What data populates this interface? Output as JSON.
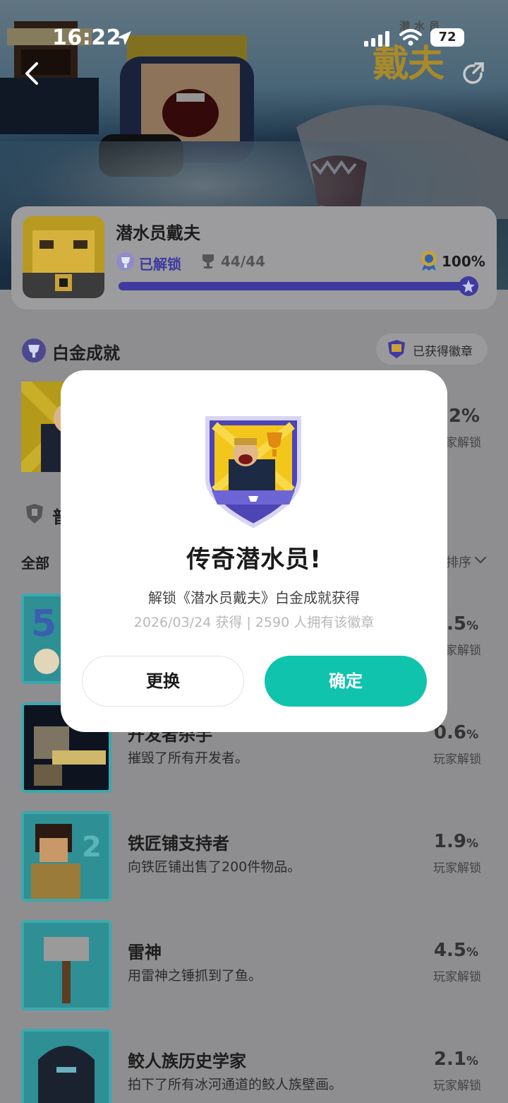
{
  "status_bar": {
    "time": "16:22",
    "battery": "72"
  },
  "logo": {
    "small": "潜水员",
    "big": "戴夫"
  },
  "game": {
    "title": "潜水员戴夫",
    "unlock_label": "已解锁",
    "count": "44/44",
    "percent": "100%",
    "progress": 1.0
  },
  "platinum": {
    "title": "白金成就",
    "badge_button": "已获得徽章",
    "pct": ".2%",
    "sub": "家解锁"
  },
  "common": {
    "title": "普"
  },
  "filter": {
    "all": "全部",
    "sort": "排序"
  },
  "achievements": [
    {
      "name": "",
      "desc": "",
      "pct": ".5",
      "sub": "家解锁"
    },
    {
      "name": "开发者杀手",
      "desc": "摧毁了所有开发者。",
      "pct": "0.6",
      "sub": "玩家解锁"
    },
    {
      "name": "铁匠铺支持者",
      "desc": "向铁匠铺出售了200件物品。",
      "pct": "1.9",
      "sub": "玩家解锁"
    },
    {
      "name": "雷神",
      "desc": "用雷神之锤抓到了鱼。",
      "pct": "4.5",
      "sub": "玩家解锁"
    },
    {
      "name": "鲛人族历史学家",
      "desc": "拍下了所有冰河通道的鲛人族壁画。",
      "pct": "2.1",
      "sub": "玩家解锁"
    }
  ],
  "pct_unit": "%",
  "modal": {
    "title": "传奇潜水员!",
    "desc": "解锁《潜水员戴夫》白金成就获得",
    "meta": "2026/03/24 获得 | 2590 人拥有该徽章",
    "change_button": "更换",
    "confirm_button": "确定"
  },
  "colors": {
    "accent": "#10c3ad",
    "unlock": "#3f3aa0"
  }
}
